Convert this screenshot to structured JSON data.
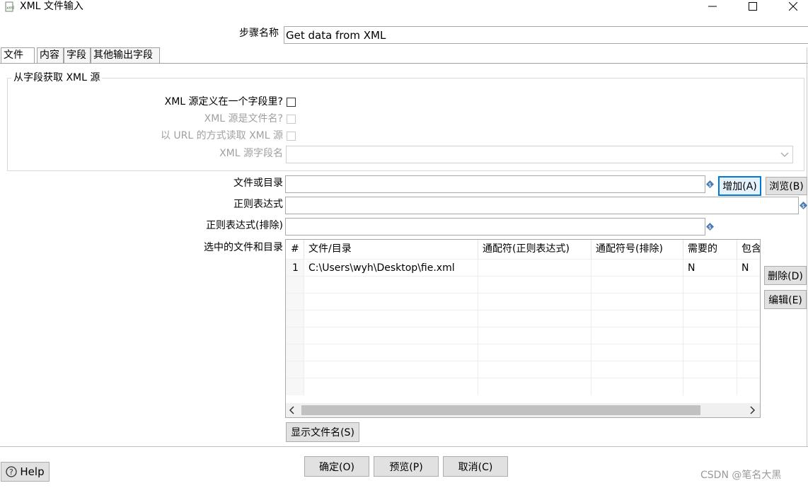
{
  "window": {
    "title": "XML 文件输入",
    "icon": "xml-file-icon"
  },
  "step_name": {
    "label": "步骤名称",
    "value": "Get data from XML"
  },
  "tabs": [
    {
      "label": "文件",
      "active": true
    },
    {
      "label": "内容",
      "active": false
    },
    {
      "label": "字段",
      "active": false
    },
    {
      "label": "其他输出字段",
      "active": false
    }
  ],
  "source_group": {
    "title": "从字段获取 XML 源",
    "xml_in_field_label": "XML 源定义在一个字段里?",
    "xml_is_filename_label": "XML 源是文件名?",
    "read_url_label": "以 URL 的方式读取 XML 源",
    "field_name_label": "XML 源字段名"
  },
  "file_section": {
    "file_or_dir_label": "文件或目录",
    "file_or_dir_value": "",
    "regex_label": "正则表达式",
    "regex_value": "",
    "regex_exclude_label": "正则表达式(排除)",
    "regex_exclude_value": "",
    "selected_files_label": "选中的文件和目录",
    "add_button": "增加(A)",
    "browse_button": "浏览(B)",
    "delete_button": "删除(D)",
    "edit_button": "编辑(E)",
    "show_files_button": "显示文件名(S)"
  },
  "table": {
    "columns": [
      "#",
      "文件/目录",
      "通配符(正则表达式)",
      "通配符号(排除)",
      "需要的",
      "包含"
    ],
    "rows": [
      [
        "1",
        "C:\\Users\\wyh\\Desktop\\fie.xml",
        "",
        "",
        "N",
        "N"
      ]
    ]
  },
  "footer": {
    "help_button": "Help",
    "ok_button": "确定(O)",
    "preview_button": "预览(P)",
    "cancel_button": "取消(C)"
  },
  "watermark": "CSDN @笔名大黑",
  "colors": {
    "focus_border": "#0078d7",
    "variable_icon": "#4a7ab0"
  }
}
